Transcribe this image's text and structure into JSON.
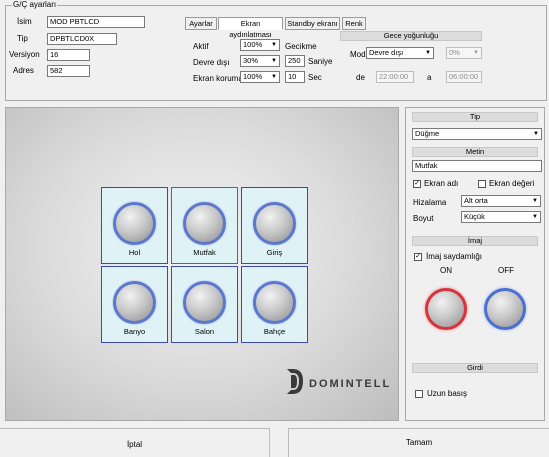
{
  "io_settings": {
    "title": "G/Ç ayarları",
    "isim_label": "İsim",
    "isim_value": "MOD PBTLCD",
    "tip_label": "Tip",
    "tip_value": "DPBTLCD0X",
    "versiyon_label": "Versiyon",
    "versiyon_value": "16",
    "adres_label": "Adres",
    "adres_value": "582"
  },
  "tabs": [
    "Ayarlar",
    "Ekran aydınlatması",
    "Standby ekranı",
    "Renk"
  ],
  "screen_lighting": {
    "aktif_label": "Aktif",
    "aktif_value": "100%",
    "devre_disi_label": "Devre dışı",
    "devre_disi_value": "30%",
    "ekran_koruma_label": "Ekran koruma",
    "ekran_koruma_value": "100%",
    "gecikme_label": "Gecikme",
    "saniye_value": "250",
    "saniye_label": "Saniye",
    "sec_value": "10",
    "sec_label": "Sec"
  },
  "night_mode": {
    "header": "Gece yoğunluğu",
    "mod_label": "Mod",
    "mod_value": "Devre dışı",
    "percent_value": "0%",
    "de_label": "de",
    "from_time": "22:00:00",
    "a_label": "a",
    "to_time": "06:00:00"
  },
  "preview_buttons": [
    {
      "label": "Hol"
    },
    {
      "label": "Mutfak"
    },
    {
      "label": "Giriş"
    },
    {
      "label": "Banyo"
    },
    {
      "label": "Salon"
    },
    {
      "label": "Bahçe"
    }
  ],
  "logo_text": "DOMINTELL",
  "side_panel": {
    "tip_header": "Tip",
    "tip_value": "Düğme",
    "metin_header": "Metin",
    "metin_value": "Mutfak",
    "ekran_adi_label": "Ekran adı",
    "ekran_adi_checked": true,
    "ekran_degeri_label": "Ekran değeri",
    "ekran_degeri_checked": false,
    "hizalama_label": "Hizalama",
    "hizalama_value": "Alt orta",
    "boyut_label": "Boyut",
    "boyut_value": "Küçük",
    "imaj_header": "İmaj",
    "imaj_saydamligi_label": "İmaj saydamlığı",
    "imaj_saydamligi_checked": true,
    "on_label": "ON",
    "off_label": "OFF",
    "girdi_header": "Girdi",
    "uzun_basis_label": "Uzun basış",
    "uzun_basis_checked": false
  },
  "footer": {
    "cancel_label": "İptal",
    "ok_label": "Tamam"
  },
  "colors": {
    "selected_border": "#d2344a",
    "cell_border": "#3a49b4",
    "cell_bg": "#dff3f6",
    "on_ring": "#d8323c",
    "off_ring": "#4a6fd0"
  }
}
